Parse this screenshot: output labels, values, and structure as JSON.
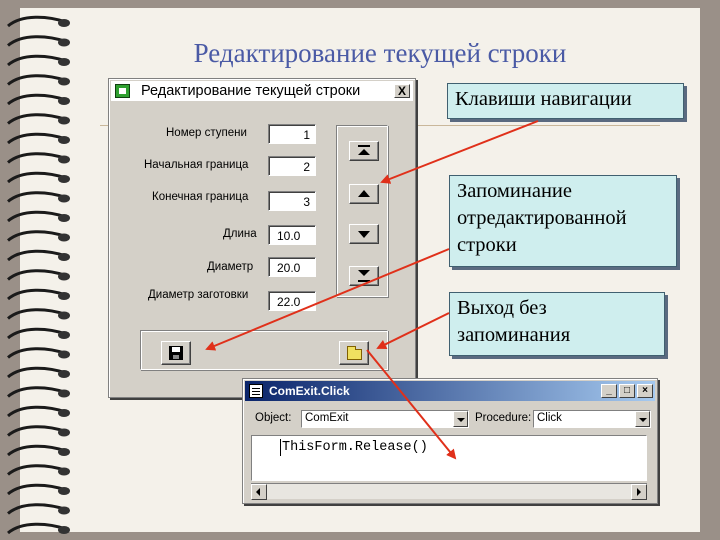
{
  "slide": {
    "title": "Редактирование текущей строки"
  },
  "form": {
    "title": "Редактирование текущей строки",
    "close_label": "X",
    "fields": [
      {
        "label": "Номер ступени",
        "value": "1"
      },
      {
        "label": "Начальная граница",
        "value": "2"
      },
      {
        "label": "Конечная граница",
        "value": "3"
      },
      {
        "label": "Длина",
        "value": "10.0"
      },
      {
        "label": "Диаметр",
        "value": "20.0"
      },
      {
        "label": "Диаметр заготовки",
        "value": "22.0"
      }
    ]
  },
  "callouts": {
    "nav": "Клавиши навигации",
    "save": "Запоминание отредактированной строки",
    "exit": "Выход без запоминания"
  },
  "code_window": {
    "title": "ComExit.Click",
    "object_label": "Object:",
    "object_value": "ComExit",
    "procedure_label": "Procedure:",
    "procedure_value": "Click",
    "code": "ThisForm.Release()"
  },
  "colors": {
    "arrow": "#e0301a",
    "title": "#4a5aa5",
    "callout_bg": "#cfeeee"
  },
  "icons": [
    "first-record-icon",
    "previous-record-icon",
    "next-record-icon",
    "last-record-icon",
    "save-icon",
    "exit-icon"
  ]
}
